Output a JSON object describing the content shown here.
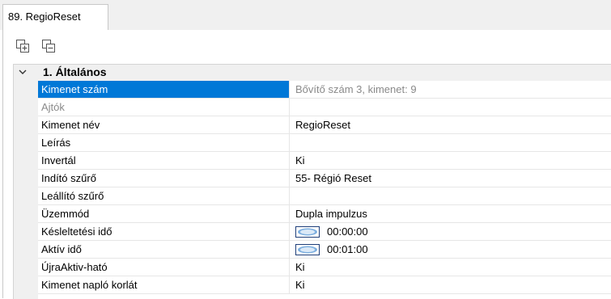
{
  "tab": {
    "label": "89. RegioReset"
  },
  "toolbar": {
    "buttons": [
      {
        "icon": "expand-all-icon"
      },
      {
        "icon": "collapse-all-icon"
      }
    ]
  },
  "category": {
    "label": "1. Általános",
    "expanded": true
  },
  "properties": [
    {
      "name": "Kimenet szám",
      "value": "Bővítő szám 3, kimenet: 9",
      "selected": true,
      "readonly": true
    },
    {
      "name": "Ajtók",
      "value": "",
      "disabled": true
    },
    {
      "name": "Kimenet név",
      "value": "RegioReset"
    },
    {
      "name": "Leírás",
      "value": ""
    },
    {
      "name": "Invertál",
      "value": "Ki"
    },
    {
      "name": "Indító szűrő",
      "value": "55- Régió Reset"
    },
    {
      "name": "Leállító szűrő",
      "value": ""
    },
    {
      "name": "Üzemmód",
      "value": "Dupla impulzus"
    },
    {
      "name": "Késleltetési idő",
      "value": "00:00:00",
      "has_time_icon": true
    },
    {
      "name": "Aktív idő",
      "value": "00:01:00",
      "has_time_icon": true
    },
    {
      "name": "ÚjraAktiv-ható",
      "value": "Ki"
    },
    {
      "name": "Kimenet napló korlát",
      "value": "Ki"
    }
  ],
  "colors": {
    "selection": "#0078d7",
    "readonly_text": "#8a8a8a"
  }
}
